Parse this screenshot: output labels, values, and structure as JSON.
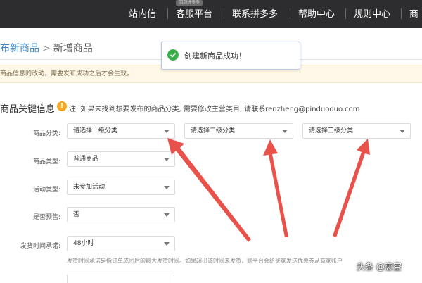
{
  "topnav": {
    "items": [
      "站内信",
      "客服平台",
      "联系拼多多",
      "帮助中心",
      "规则中心",
      "商"
    ],
    "badge": "回到拼多多"
  },
  "breadcrumb": {
    "parent": "布新商品",
    "separator": ">",
    "current": "新增商品"
  },
  "toast": {
    "message": "创建新商品成功！"
  },
  "notice": {
    "text": "商品信息的改动，需要发布成功之后才会生效。"
  },
  "section": {
    "title": "商品关键信息",
    "warning": "注: 如果未找到想要发布的商品分类, 需要修改主营类目, 请联系renzheng@pinduoduo.com"
  },
  "form": {
    "category_label": "商品分类:",
    "category_level1": "请选择一级分类",
    "category_level2": "请选择二级分类",
    "category_level3": "请选择三级分类",
    "type_label": "商品类型:",
    "type_value": "普通商品",
    "activity_label": "活动类型:",
    "activity_value": "未参加活动",
    "presale_label": "是否预售:",
    "presale_value": "否",
    "ship_label": "发货时间承诺:",
    "ship_value": "48小时",
    "ship_hint": "发货时间承诺是指订单成团后的最大发货时间。如果超出该时间未发货，则平台会给买家发送优惠券从商家账户"
  },
  "watermark": {
    "text": "头条 @恋空"
  },
  "colors": {
    "topbar": "#2d2d2f",
    "arrow": "#e8524a",
    "success": "#3ab04a",
    "warning": "#f5a623",
    "link": "#3a86c8"
  }
}
